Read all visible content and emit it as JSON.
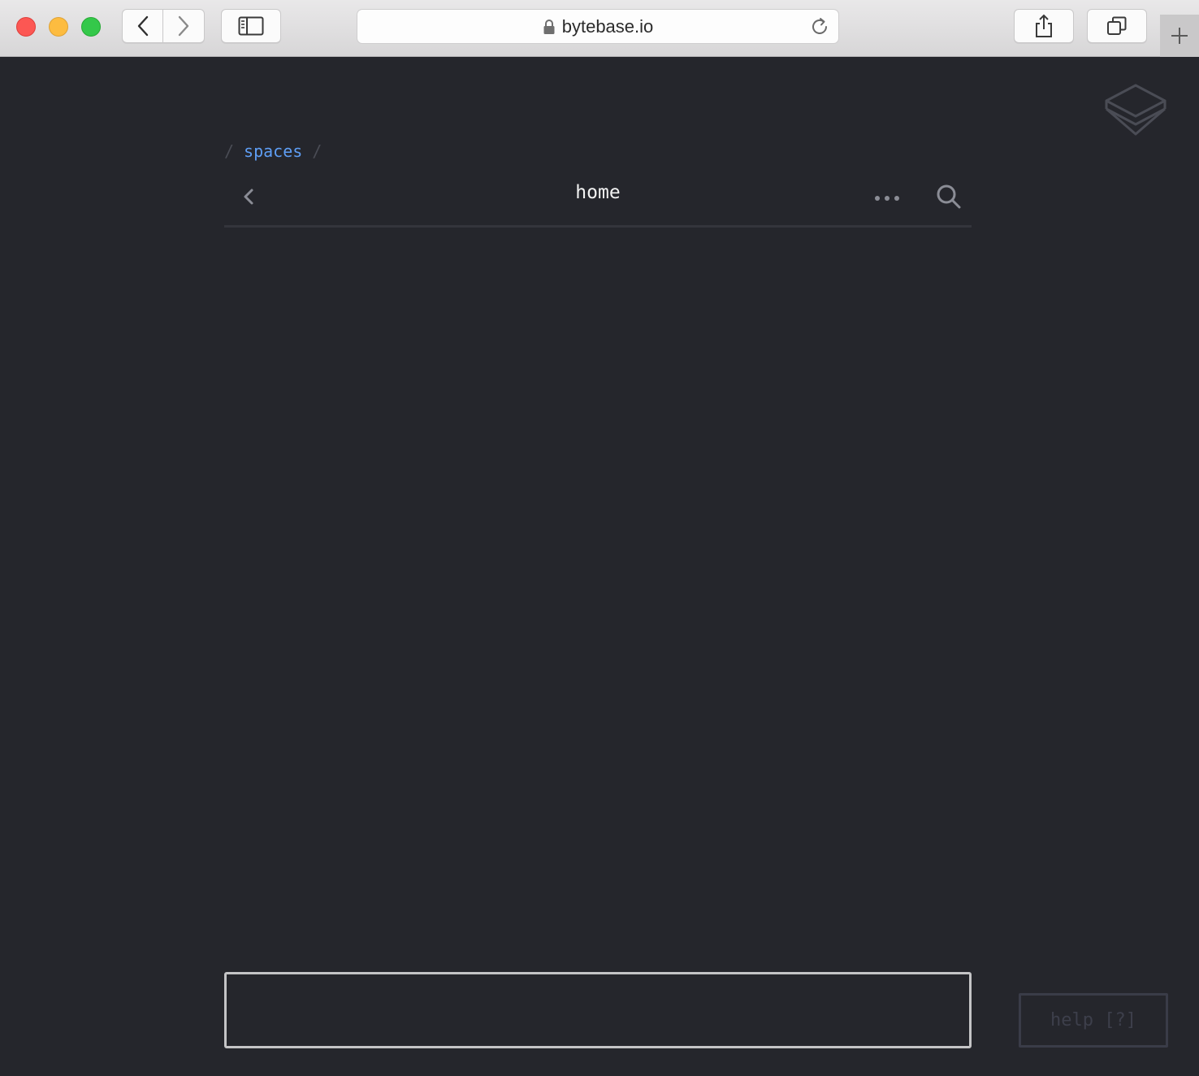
{
  "browser": {
    "url": "bytebase.io",
    "buttons": {
      "back": "back",
      "forward": "forward",
      "sidebar": "sidebar",
      "share": "share",
      "tabs": "tabs",
      "new_tab": "new tab"
    }
  },
  "page": {
    "breadcrumb": {
      "separator": "/",
      "items": [
        {
          "label": "spaces"
        }
      ]
    },
    "header": {
      "title": "home"
    },
    "command_input": {
      "value": "",
      "placeholder": ""
    },
    "help_button": {
      "label": "help [?]"
    }
  },
  "colors": {
    "background": "#25262c",
    "link": "#5e9ef5",
    "title": "#f2f2f2",
    "input_border": "#c4c4c6",
    "help_muted": "#3d3f4b"
  },
  "icons": [
    "lock-icon",
    "reload-icon",
    "chevron-left-icon",
    "chevron-right-icon",
    "sidebar-icon",
    "share-icon",
    "tabs-icon",
    "plus-icon",
    "layers-logo-icon",
    "ellipsis-icon",
    "search-icon"
  ]
}
